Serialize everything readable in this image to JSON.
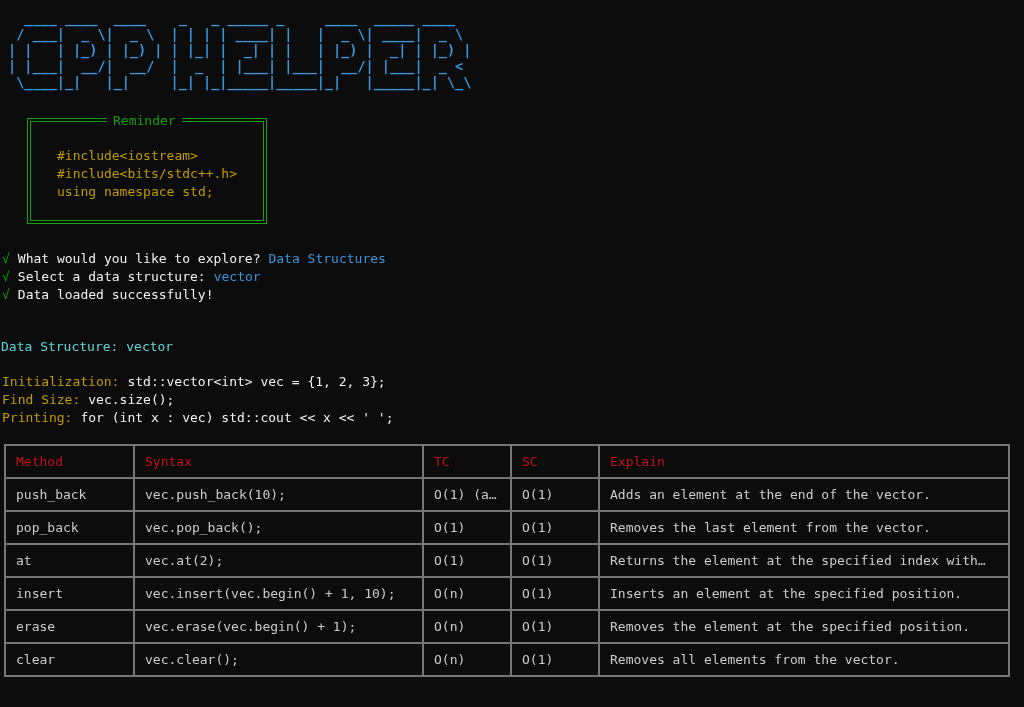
{
  "banner": {
    "lines": [
      "  ____ ____  ____    _   _ _____ _     ____  _____ ____  ",
      " / ___|  _ \\|  _ \\  | | | | ____| |   |  _ \\| ____|  _ \\ ",
      "| |   | |_) | |_) | | |_| |  _| | |   | |_) |  _| | |_) |",
      "| |___|  __/|  __/  |  _  | |___| |___|  __/| |___|  _ < ",
      " \\____|_|   |_|     |_| |_|_____|_____|_|   |_____|_| \\_\\"
    ]
  },
  "reminder": {
    "title": "Reminder",
    "lines": [
      "#include<iostream>",
      "#include<bits/stdc++.h>",
      "using namespace std;"
    ]
  },
  "prompts": [
    {
      "mark": "√",
      "text": "What would you like to explore?",
      "answer": "Data Structures"
    },
    {
      "mark": "√",
      "text": "Select a data structure:",
      "answer": "vector"
    },
    {
      "mark": "√",
      "text": "Data loaded successfully!"
    }
  ],
  "heading": "Data Structure: vector",
  "details": [
    {
      "label": "Initialization:",
      "value": "std::vector<int> vec = {1, 2, 3};"
    },
    {
      "label": "Find Size:",
      "value": "vec.size();"
    },
    {
      "label": "Printing:",
      "value": "for (int x : vec) std::cout << x << ' ';"
    }
  ],
  "table": {
    "columns": [
      "Method",
      "Syntax",
      "TC",
      "SC",
      "Explain"
    ],
    "rows": [
      [
        "push_back",
        "vec.push_back(10);",
        "O(1) (a…",
        "O(1)",
        "Adds an element at the end of the vector."
      ],
      [
        "pop_back",
        "vec.pop_back();",
        "O(1)",
        "O(1)",
        "Removes the last element from the vector."
      ],
      [
        "at",
        "vec.at(2);",
        "O(1)",
        "O(1)",
        "Returns the element at the specified index with…"
      ],
      [
        "insert",
        "vec.insert(vec.begin() + 1, 10);",
        "O(n)",
        "O(1)",
        "Inserts an element at the specified position."
      ],
      [
        "erase",
        "vec.erase(vec.begin() + 1);",
        "O(n)",
        "O(1)",
        "Removes the element at the specified position."
      ],
      [
        "clear",
        "vec.clear();",
        "O(n)",
        "O(1)",
        "Removes all elements from the vector."
      ]
    ]
  }
}
